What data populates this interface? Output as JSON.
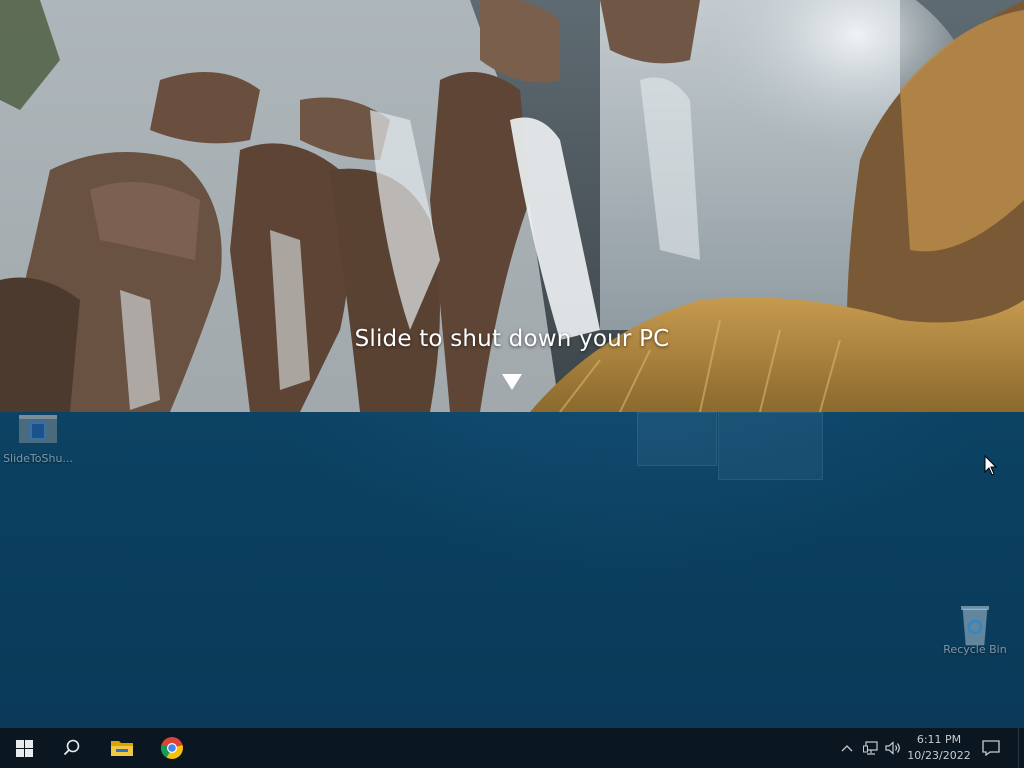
{
  "slide_panel": {
    "prompt": "Slide to shut down your PC"
  },
  "desktop": {
    "icons": [
      {
        "label": "SlideToShu...",
        "icon": "shortcut-window-icon"
      },
      {
        "label": "Recycle Bin",
        "icon": "recycle-bin-icon"
      }
    ]
  },
  "taskbar": {
    "apps": [
      {
        "name": "Start",
        "icon": "windows-logo-icon"
      },
      {
        "name": "Search",
        "icon": "search-icon"
      },
      {
        "name": "File Explorer",
        "icon": "folder-icon"
      },
      {
        "name": "Google Chrome",
        "icon": "chrome-icon"
      }
    ],
    "tray": {
      "icons": [
        "chevron-up-icon",
        "network-icon",
        "volume-icon"
      ],
      "time": "6:11 PM",
      "date": "10/23/2022",
      "notification_icon": "notification-icon"
    }
  },
  "colors": {
    "desktop_blue": "#0c4466",
    "taskbar": "#0a1620",
    "text_white": "#ffffff"
  }
}
